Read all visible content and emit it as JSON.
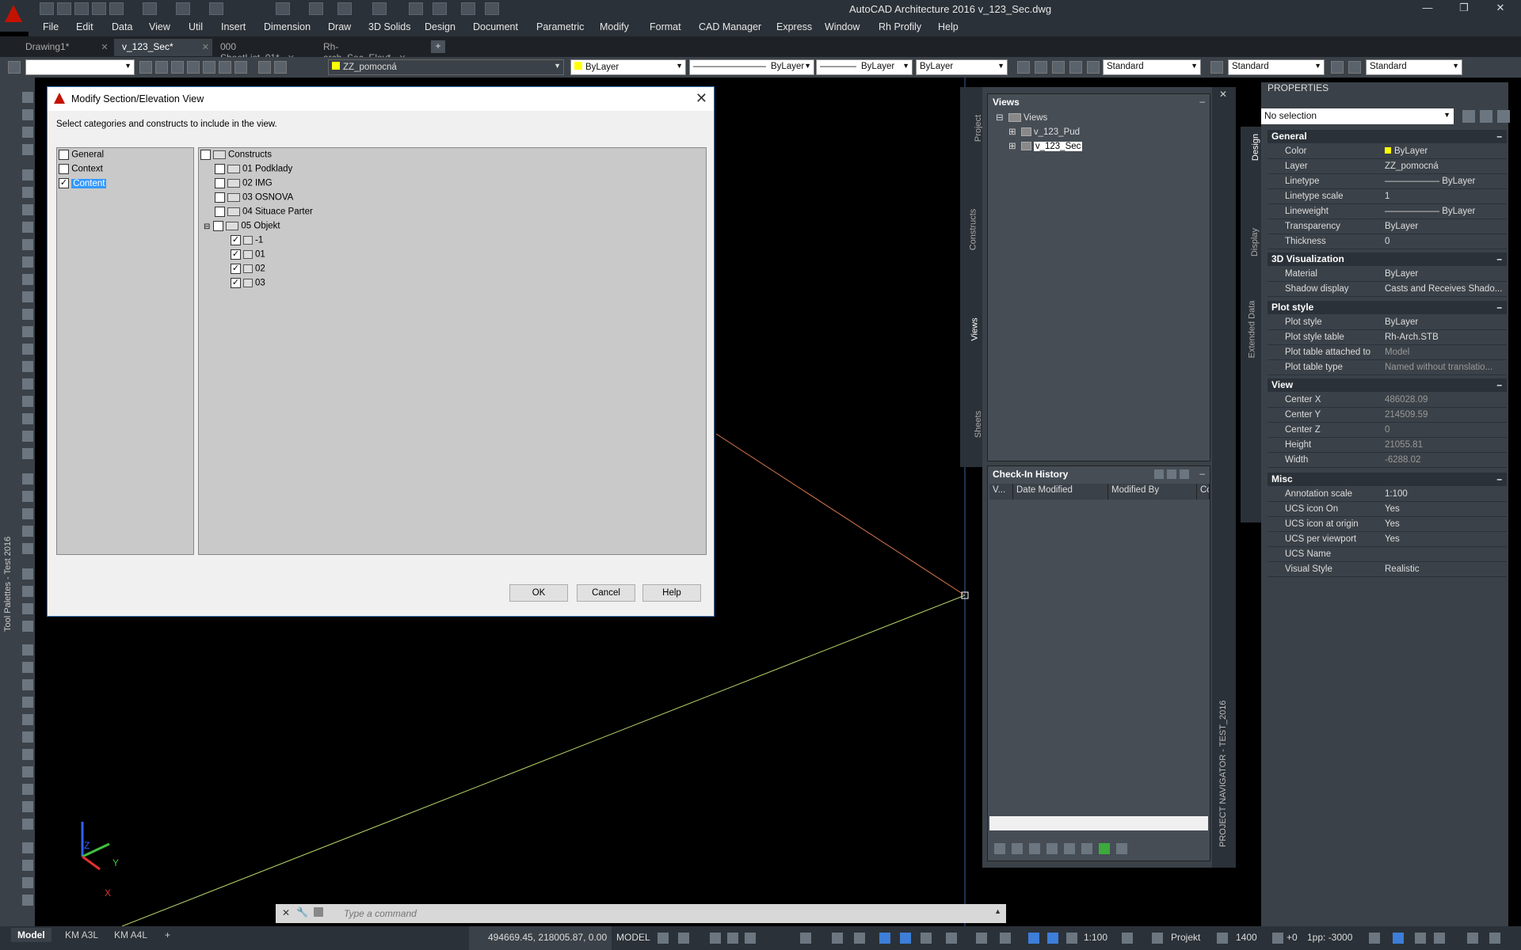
{
  "window": {
    "title": "AutoCAD Architecture 2016    v_123_Sec.dwg",
    "controls": [
      "—",
      "❐",
      "✕"
    ]
  },
  "menu": [
    "File",
    "Edit",
    "Data",
    "View",
    "Util",
    "Insert",
    "Dimension",
    "Draw",
    "3D Solids",
    "Design",
    "Document",
    "Parametric",
    "Modify",
    "Format",
    "CAD Manager",
    "Express",
    "Window",
    "Rh Profily",
    "Help"
  ],
  "tabs": [
    {
      "label": "Drawing1*",
      "active": false
    },
    {
      "label": "v_123_Sec*",
      "active": true
    },
    {
      "label": "000 SheetList_01*",
      "active": false
    },
    {
      "label": "Rh-arch_Sec_Elev*",
      "active": false
    }
  ],
  "toolbar": {
    "layer": "ZZ_pomocná",
    "color": "ByLayer",
    "linetype": "ByLayer",
    "lineweight": "ByLayer",
    "plotstyle": "ByLayer",
    "textstyle": "Standard",
    "dimstyle": "Standard",
    "tablestyle": "Standard"
  },
  "left_palette": {
    "label": "Tool Palettes - Test 2016"
  },
  "dialog": {
    "title": "Modify Section/Elevation View",
    "prompt": "Select categories and constructs to include in the view.",
    "categories": [
      {
        "label": "General",
        "checked": false
      },
      {
        "label": "Context",
        "checked": false
      },
      {
        "label": "Content",
        "checked": true
      }
    ],
    "constructs_root": "Constructs",
    "constructs": [
      {
        "label": "01 Podklady",
        "checked": false
      },
      {
        "label": "02 IMG",
        "checked": false
      },
      {
        "label": "03 OSNOVA",
        "checked": false
      },
      {
        "label": "04 Situace Parter",
        "checked": false
      },
      {
        "label": "05 Objekt",
        "checked": false
      }
    ],
    "objekt_children": [
      {
        "label": "-1",
        "checked": true
      },
      {
        "label": "01",
        "checked": true
      },
      {
        "label": "02",
        "checked": true
      },
      {
        "label": "03",
        "checked": true
      }
    ],
    "buttons": {
      "ok": "OK",
      "cancel": "Cancel",
      "help": "Help"
    }
  },
  "navigator": {
    "side_tabs": [
      "Project",
      "Constructs",
      "Views",
      "Sheets"
    ],
    "vertical_label": "PROJECT NAVIGATOR - TEST_2016",
    "views_title": "Views",
    "views_root": "Views",
    "views_items": [
      "v_123_Pud",
      "v_123_Sec"
    ],
    "checkin_title": "Check-In History",
    "checkin_columns": [
      "V...",
      "Date Modified",
      "Modified By",
      "Com"
    ]
  },
  "properties": {
    "header": "PROPERTIES",
    "selection": "No selection",
    "side_tabs": [
      "Design",
      "Display",
      "Extended Data"
    ],
    "sections": {
      "general": "General",
      "visualization": "3D Visualization",
      "plot": "Plot style",
      "view": "View",
      "misc": "Misc"
    },
    "general": [
      {
        "k": "Color",
        "v": "ByLayer"
      },
      {
        "k": "Layer",
        "v": "ZZ_pomocná"
      },
      {
        "k": "Linetype",
        "v": "——————  ByLayer"
      },
      {
        "k": "Linetype scale",
        "v": "1"
      },
      {
        "k": "Lineweight",
        "v": "——————  ByLayer"
      },
      {
        "k": "Transparency",
        "v": "ByLayer"
      },
      {
        "k": "Thickness",
        "v": "0"
      }
    ],
    "visualization": [
      {
        "k": "Material",
        "v": "ByLayer"
      },
      {
        "k": "Shadow display",
        "v": "Casts and Receives Shado..."
      }
    ],
    "plot": [
      {
        "k": "Plot style",
        "v": "ByLayer"
      },
      {
        "k": "Plot style table",
        "v": "Rh-Arch.STB"
      },
      {
        "k": "Plot table attached to",
        "v": "Model"
      },
      {
        "k": "Plot table type",
        "v": "Named without translatio..."
      }
    ],
    "view": [
      {
        "k": "Center X",
        "v": "486028.09"
      },
      {
        "k": "Center Y",
        "v": "214509.59"
      },
      {
        "k": "Center Z",
        "v": "0"
      },
      {
        "k": "Height",
        "v": "21055.81"
      },
      {
        "k": "Width",
        "v": "-6288.02"
      }
    ],
    "misc": [
      {
        "k": "Annotation scale",
        "v": "1:100"
      },
      {
        "k": "UCS icon On",
        "v": "Yes"
      },
      {
        "k": "UCS icon at origin",
        "v": "Yes"
      },
      {
        "k": "UCS per viewport",
        "v": "Yes"
      },
      {
        "k": "UCS Name",
        "v": ""
      },
      {
        "k": "Visual Style",
        "v": "Realistic"
      }
    ]
  },
  "command": {
    "placeholder": "Type a command"
  },
  "ucs": {
    "x": "X",
    "y": "Y",
    "z": "Z"
  },
  "status": {
    "layout_tabs": [
      "Model",
      "KM A3L",
      "KM A4L"
    ],
    "coords": "494669.45, 218005.87, 0.00",
    "model": "MODEL",
    "scale": "1:100",
    "project": "Projekt",
    "elevation": "1400",
    "offset": "+0",
    "cut": "1pp: -3000"
  }
}
